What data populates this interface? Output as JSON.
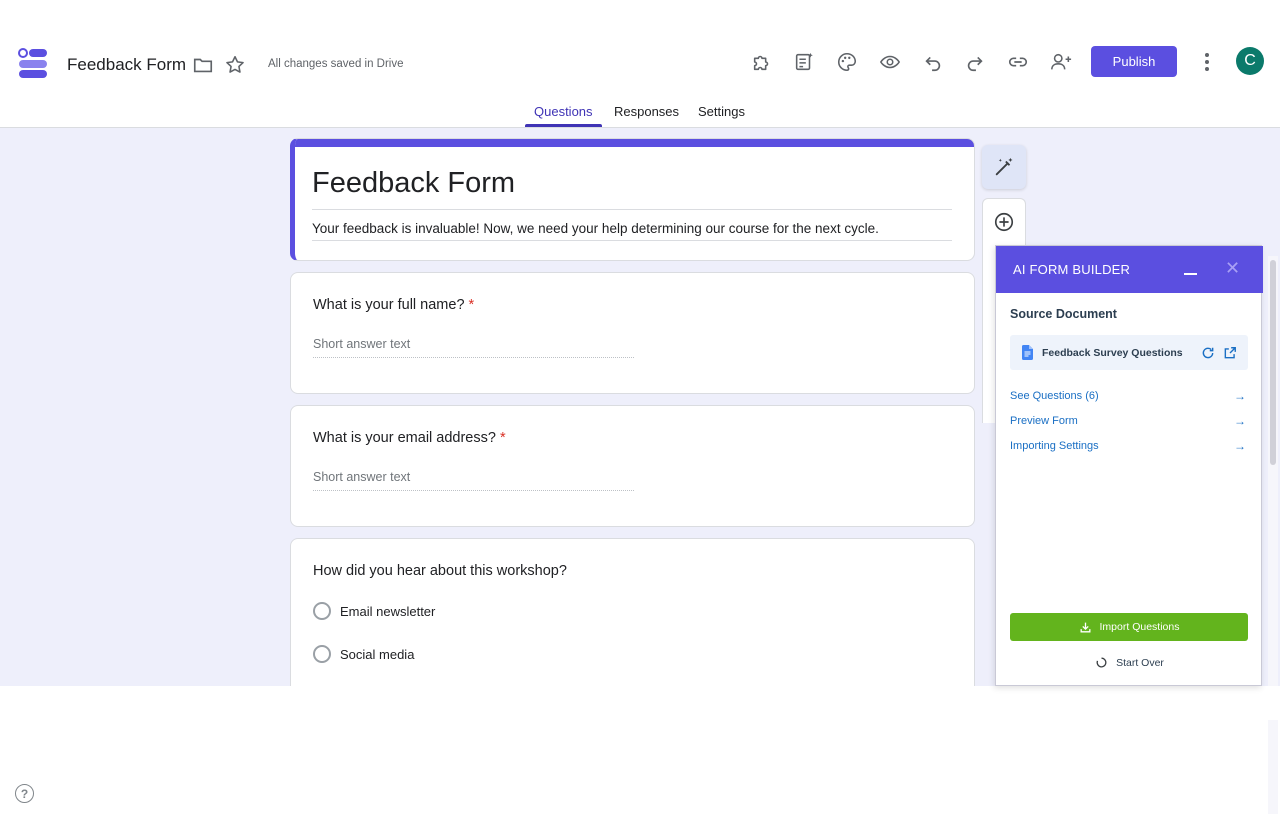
{
  "header": {
    "form_title": "Feedback Form",
    "saved_status": "All changes saved in Drive",
    "publish_label": "Publish",
    "avatar_initial": "C",
    "brand_color": "#5b4fe0"
  },
  "tabs": [
    {
      "label": "Questions",
      "active": true
    },
    {
      "label": "Responses",
      "active": false
    },
    {
      "label": "Settings",
      "active": false
    }
  ],
  "form": {
    "title": "Feedback Form",
    "description": "Your feedback is invaluable! Now, we need your help determining our course for the next cycle.",
    "questions": [
      {
        "title": "What is your full name?",
        "required": "*",
        "placeholder": "Short answer text"
      },
      {
        "title": "What is your email address?",
        "required": "*",
        "placeholder": "Short answer text"
      },
      {
        "title": "How did you hear about this workshop?",
        "options": [
          "Email newsletter",
          "Social media"
        ]
      }
    ]
  },
  "ai_panel": {
    "title": "AI FORM BUILDER",
    "source_label": "Source Document",
    "document_name": "Feedback Survey Questions",
    "links": [
      "See Questions (6)",
      "Preview Form",
      "Importing Settings"
    ],
    "import_label": "Import Questions",
    "start_over_label": "Start Over",
    "import_color": "#63b41d"
  }
}
